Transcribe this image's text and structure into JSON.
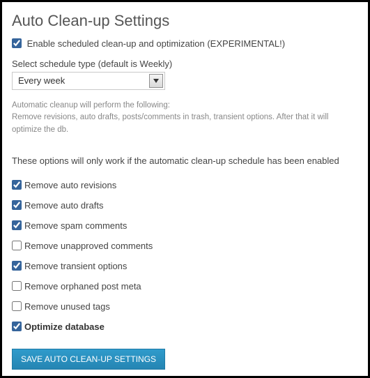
{
  "title": "Auto Clean-up Settings",
  "enable": {
    "label": "Enable scheduled clean-up and optimization (EXPERIMENTAL!)",
    "checked": true
  },
  "schedule": {
    "label": "Select schedule type (default is Weekly)",
    "selected": "Every week"
  },
  "info": {
    "line1": "Automatic cleanup will perform the following:",
    "line2": "Remove revisions, auto drafts, posts/comments in trash, transient options. After that it will optimize the db."
  },
  "warn": "These options will only work if the automatic clean-up schedule has been enabled",
  "options": [
    {
      "label": "Remove auto revisions",
      "checked": true,
      "bold": false
    },
    {
      "label": "Remove auto drafts",
      "checked": true,
      "bold": false
    },
    {
      "label": "Remove spam comments",
      "checked": true,
      "bold": false
    },
    {
      "label": "Remove unapproved comments",
      "checked": false,
      "bold": false
    },
    {
      "label": "Remove transient options",
      "checked": true,
      "bold": false
    },
    {
      "label": "Remove orphaned post meta",
      "checked": false,
      "bold": false
    },
    {
      "label": "Remove unused tags",
      "checked": false,
      "bold": false
    },
    {
      "label": "Optimize database",
      "checked": true,
      "bold": true
    }
  ],
  "save_label": "SAVE AUTO CLEAN-UP SETTINGS"
}
